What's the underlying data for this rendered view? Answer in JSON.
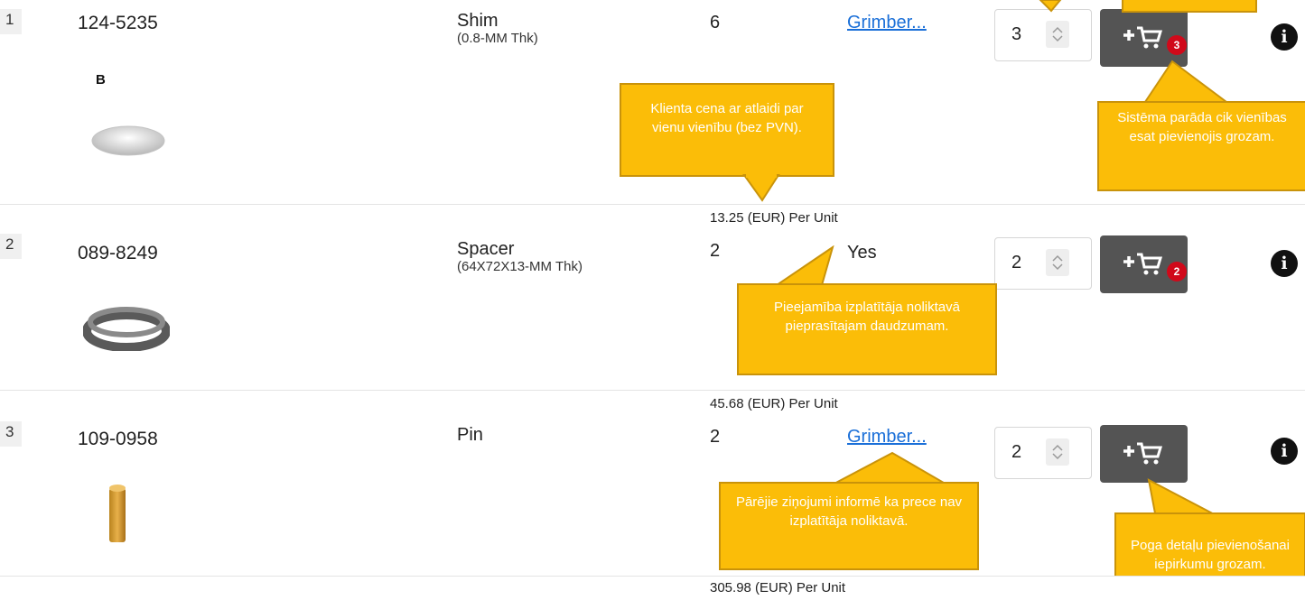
{
  "rows": [
    {
      "index": "1",
      "part_no": "124-5235",
      "name": "Shim",
      "spec": "(0.8-MM Thk)",
      "qty": "6",
      "availability": "Grimber...",
      "availability_link": true,
      "stepper_value": "3",
      "cart_count": "3",
      "price": "13.25 (EUR) Per Unit",
      "extra_label": "B"
    },
    {
      "index": "2",
      "part_no": "089-8249",
      "name": "Spacer",
      "spec": "(64X72X13-MM Thk)",
      "qty": "2",
      "availability": "Yes",
      "availability_link": false,
      "stepper_value": "2",
      "cart_count": "2",
      "price": "45.68 (EUR) Per Unit"
    },
    {
      "index": "3",
      "part_no": "109-0958",
      "name": "Pin",
      "spec": "",
      "qty": "2",
      "availability": "Grimber...",
      "availability_link": true,
      "stepper_value": "2",
      "cart_count": "",
      "price": "305.98 (EUR) Per Unit"
    }
  ],
  "callouts": {
    "price_note": "Klienta cena ar atlaidi par vienu vienību (bez PVN).",
    "cart_count_note": "Sistēma parāda cik vienības esat pievienojis grozam.",
    "stock_note": "Pieejamība izplatītāja noliktavā pieprasītajam daudzumam.",
    "other_msgs_note": "Pārējie ziņojumi informē ka prece nav izplatītāja noliktavā.",
    "add_button_note": "Poga detaļu pievienošanai iepirkumu grozam."
  },
  "icons": {
    "info": "info-icon",
    "cart": "cart-plus-icon",
    "stepper": "stepper-arrows-icon"
  },
  "colors": {
    "callout": "#fbbd08",
    "cart_button": "#545454",
    "badge": "#d0091a",
    "link": "#1a6fd8"
  }
}
